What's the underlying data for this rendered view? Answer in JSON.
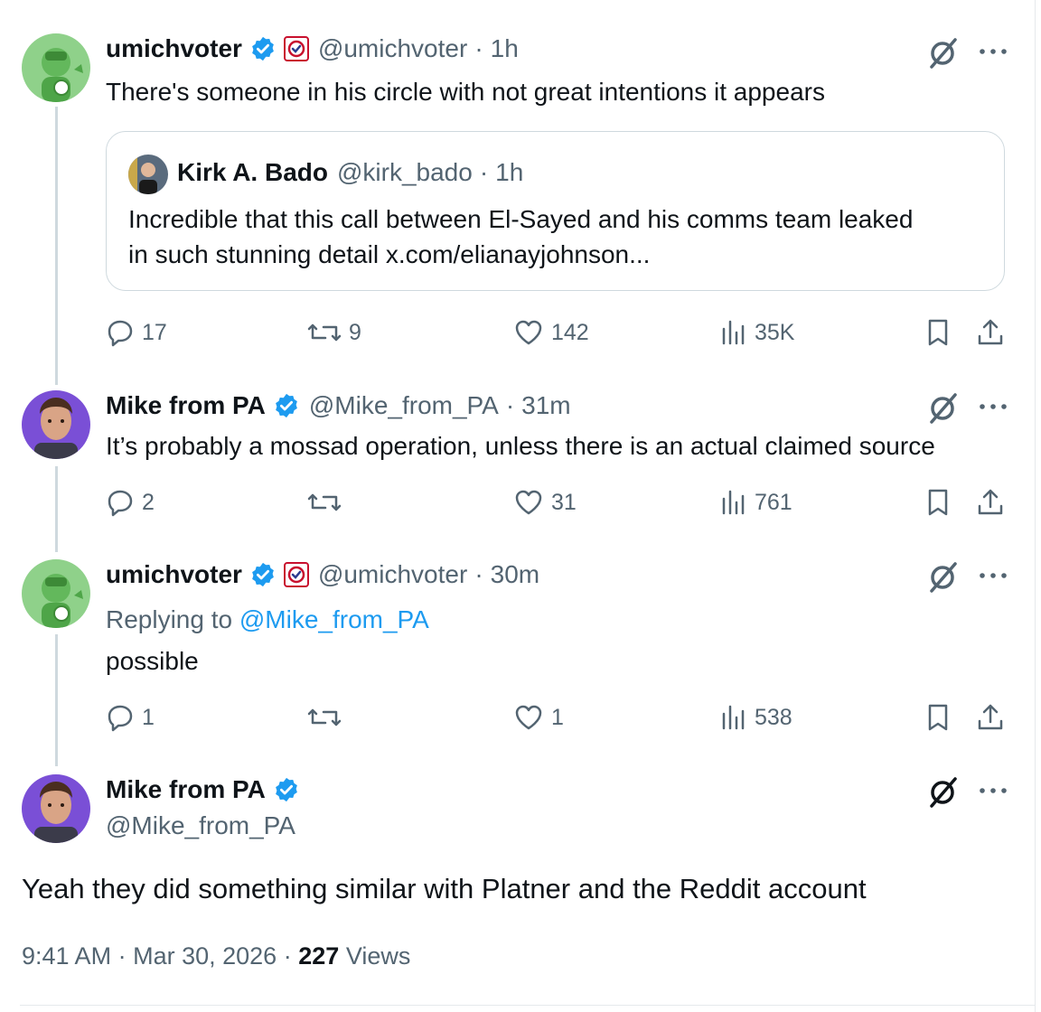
{
  "tweets": [
    {
      "name": "umichvoter",
      "handle": "@umichvoter",
      "sep": "·",
      "time": "1h",
      "text": "There's someone in his circle with not great intentions it appears",
      "quote": {
        "name": "Kirk A. Bado",
        "handle": "@kirk_bado",
        "sep": "·",
        "time": "1h",
        "line1": "Incredible that this call between El-Sayed and his comms team leaked",
        "line2": "in such stunning detail x.com/elianayjohnson..."
      },
      "stats": {
        "replies": "17",
        "reposts": "9",
        "likes": "142",
        "views": "35K"
      }
    },
    {
      "name": "Mike from PA",
      "handle": "@Mike_from_PA",
      "sep": "·",
      "time": "31m",
      "text": "It’s probably a mossad operation, unless there is an actual claimed source",
      "stats": {
        "replies": "2",
        "reposts": "",
        "likes": "31",
        "views": "761"
      }
    },
    {
      "name": "umichvoter",
      "handle": "@umichvoter",
      "sep": "·",
      "time": "30m",
      "replying_prefix": "Replying to ",
      "replying_to": "@Mike_from_PA",
      "text": "possible",
      "stats": {
        "replies": "1",
        "reposts": "",
        "likes": "1",
        "views": "538"
      }
    }
  ],
  "main_tweet": {
    "name": "Mike from PA",
    "handle": "@Mike_from_PA",
    "text": "Yeah they did something similar with Platner and the Reddit account",
    "time": "9:41 AM",
    "sep1": "·",
    "date": "Mar 30, 2026",
    "sep2": "·",
    "views_count": "227",
    "views_label": "Views"
  },
  "colors": {
    "verified": "#1d9bf0",
    "muted": "#536471",
    "text": "#0f1419",
    "line": "#cfd9de"
  }
}
